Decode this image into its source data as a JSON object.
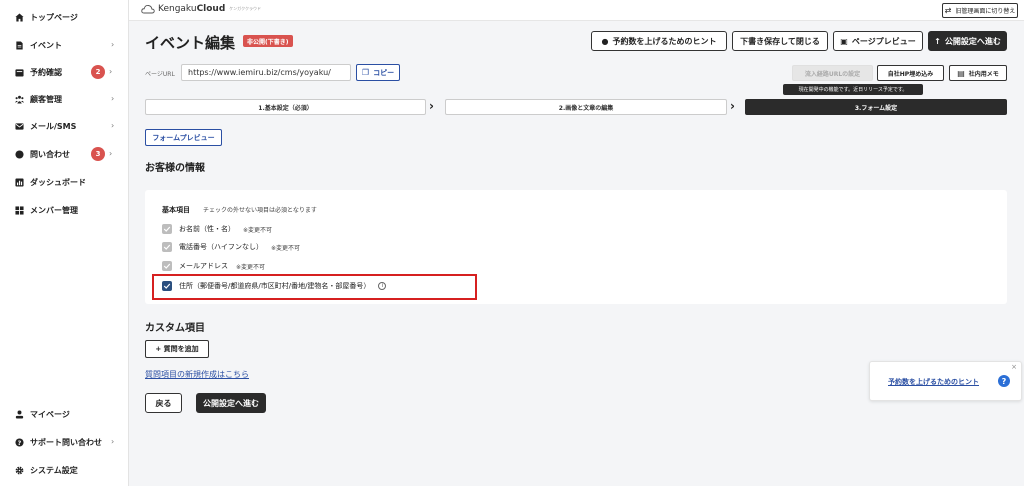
{
  "sidebar": {
    "items": [
      {
        "label": "トップページ",
        "icon": "home-icon",
        "chevron": ""
      },
      {
        "label": "イベント",
        "icon": "document-icon",
        "chevron": "›"
      },
      {
        "label": "予約確認",
        "icon": "inbox-icon",
        "badge": "2",
        "chevron": "›"
      },
      {
        "label": "顧客管理",
        "icon": "people-icon",
        "chevron": "›"
      },
      {
        "label": "メール/SMS",
        "icon": "mail-icon",
        "chevron": "›"
      },
      {
        "label": "問い合わせ",
        "icon": "chat-icon",
        "badge": "3",
        "chevron": "›"
      },
      {
        "label": "ダッシュボード",
        "icon": "chart-icon",
        "chevron": ""
      },
      {
        "label": "メンバー管理",
        "icon": "grid-icon",
        "chevron": ""
      }
    ],
    "bottom_items": [
      {
        "label": "マイページ",
        "icon": "user-icon",
        "chevron": ""
      },
      {
        "label": "サポート問い合わせ",
        "icon": "help-icon",
        "chevron": "›"
      },
      {
        "label": "システム設定",
        "icon": "gear-icon",
        "chevron": ""
      }
    ]
  },
  "topbar": {
    "logo_prefix": "Kengaku",
    "logo_bold": "Cloud",
    "logo_sub": "ケンガククラウド",
    "old_admin_label": "旧管理画面に切り替え"
  },
  "header": {
    "title": "イベント編集",
    "status_badge": "非公開(下書き)",
    "hint_button": "予約数を上げるためのヒント",
    "save_close_button": "下書き保存して閉じる",
    "preview_button": "ページプレビュー",
    "publish_button": "公開設定へ進む"
  },
  "url_row": {
    "label": "ページURL",
    "url": "https://www.iemiru.biz/cms/yoyaku/",
    "copy_button": "コピー",
    "inflow_button": "流入経路URLの設定",
    "embed_button": "自社HP埋め込み",
    "memo_button": "社内用メモ",
    "tooltip": "現在開発中の機能です。近日リリース予定です。"
  },
  "steps": [
    {
      "label": "1.基本設定（必須）"
    },
    {
      "label": "2.画像と文章の編集"
    },
    {
      "label": "3.フォーム設定"
    }
  ],
  "form_preview_button": "フォームプレビュー",
  "customer_section": {
    "title": "お客様の情報",
    "basic_label": "基本項目",
    "basic_note": "チェックの外せない項目は必須となります",
    "fields": [
      {
        "label": "お名前（性・名）",
        "note": "※変更不可"
      },
      {
        "label": "電話番号（ハイフンなし）",
        "note": "※変更不可"
      },
      {
        "label": "メールアドレス",
        "note": "※変更不可"
      },
      {
        "label": "住所（郵便番号/都道府県/市区町村/番地/建物名・部屋番号）",
        "note": ""
      }
    ]
  },
  "custom_section": {
    "title": "カスタム項目",
    "add_button": "+ 質問を追加",
    "new_link": "質問項目の新規作成はこちら"
  },
  "footer": {
    "back_button": "戻る",
    "next_button": "公開設定へ進む"
  },
  "hint_card": {
    "link": "予約数を上げるためのヒント",
    "close": "×",
    "help": "?"
  },
  "colors": {
    "accent_dark": "#2b2b2b",
    "link_blue": "#2b4fa3",
    "badge_red": "#d9534f",
    "highlight_red": "#d62020"
  }
}
